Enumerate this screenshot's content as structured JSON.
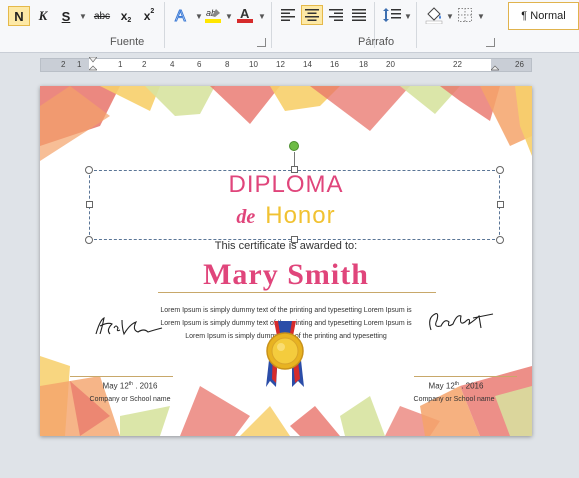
{
  "ribbon": {
    "bold": "N",
    "italic": "K",
    "underline": "S",
    "strike": "abc",
    "subscript_base": "x",
    "subscript_mark": "2",
    "superscript_base": "x",
    "superscript_mark": "2",
    "highlight_label": "ab",
    "font_color_label": "A",
    "group_font": "Fuente",
    "group_paragraph": "Párrafo",
    "style_normal": "¶ Normal"
  },
  "ruler": {
    "numbers": [
      "2",
      "1",
      "",
      "1",
      "2",
      "4",
      "6",
      "8",
      "10",
      "12",
      "14",
      "16",
      "18",
      "20",
      "22",
      "26"
    ]
  },
  "certificate": {
    "title": "DIPLOMA",
    "de": "de",
    "honor": "Honor",
    "awarded": "This certificate is awarded to:",
    "name": "Mary Smith",
    "lorem1": "Lorem Ipsum is simply dummy text of the printing and typesetting Lorem Ipsum is",
    "lorem2": "Lorem Ipsum is simply dummy text of the printing and typesetting Lorem Ipsum is",
    "lorem3": "Lorem Ipsum is simply dummy text of the printing and typesetting",
    "left_date_main": "May 12",
    "left_date_sup": "th",
    "left_date_year": ". 2016",
    "left_org": "Company or School name",
    "right_date_main": "May 12",
    "right_date_sup": "th",
    "right_date_year": ". 2016",
    "right_org": "Company or School name"
  },
  "colors": {
    "accent_pink": "#e0457b",
    "accent_gold": "#f1c232",
    "confetti_coral": "#e8736a",
    "confetti_orange": "#f4a36a",
    "confetti_yellow": "#f7cf6a",
    "confetti_green": "#d7e3a0"
  }
}
